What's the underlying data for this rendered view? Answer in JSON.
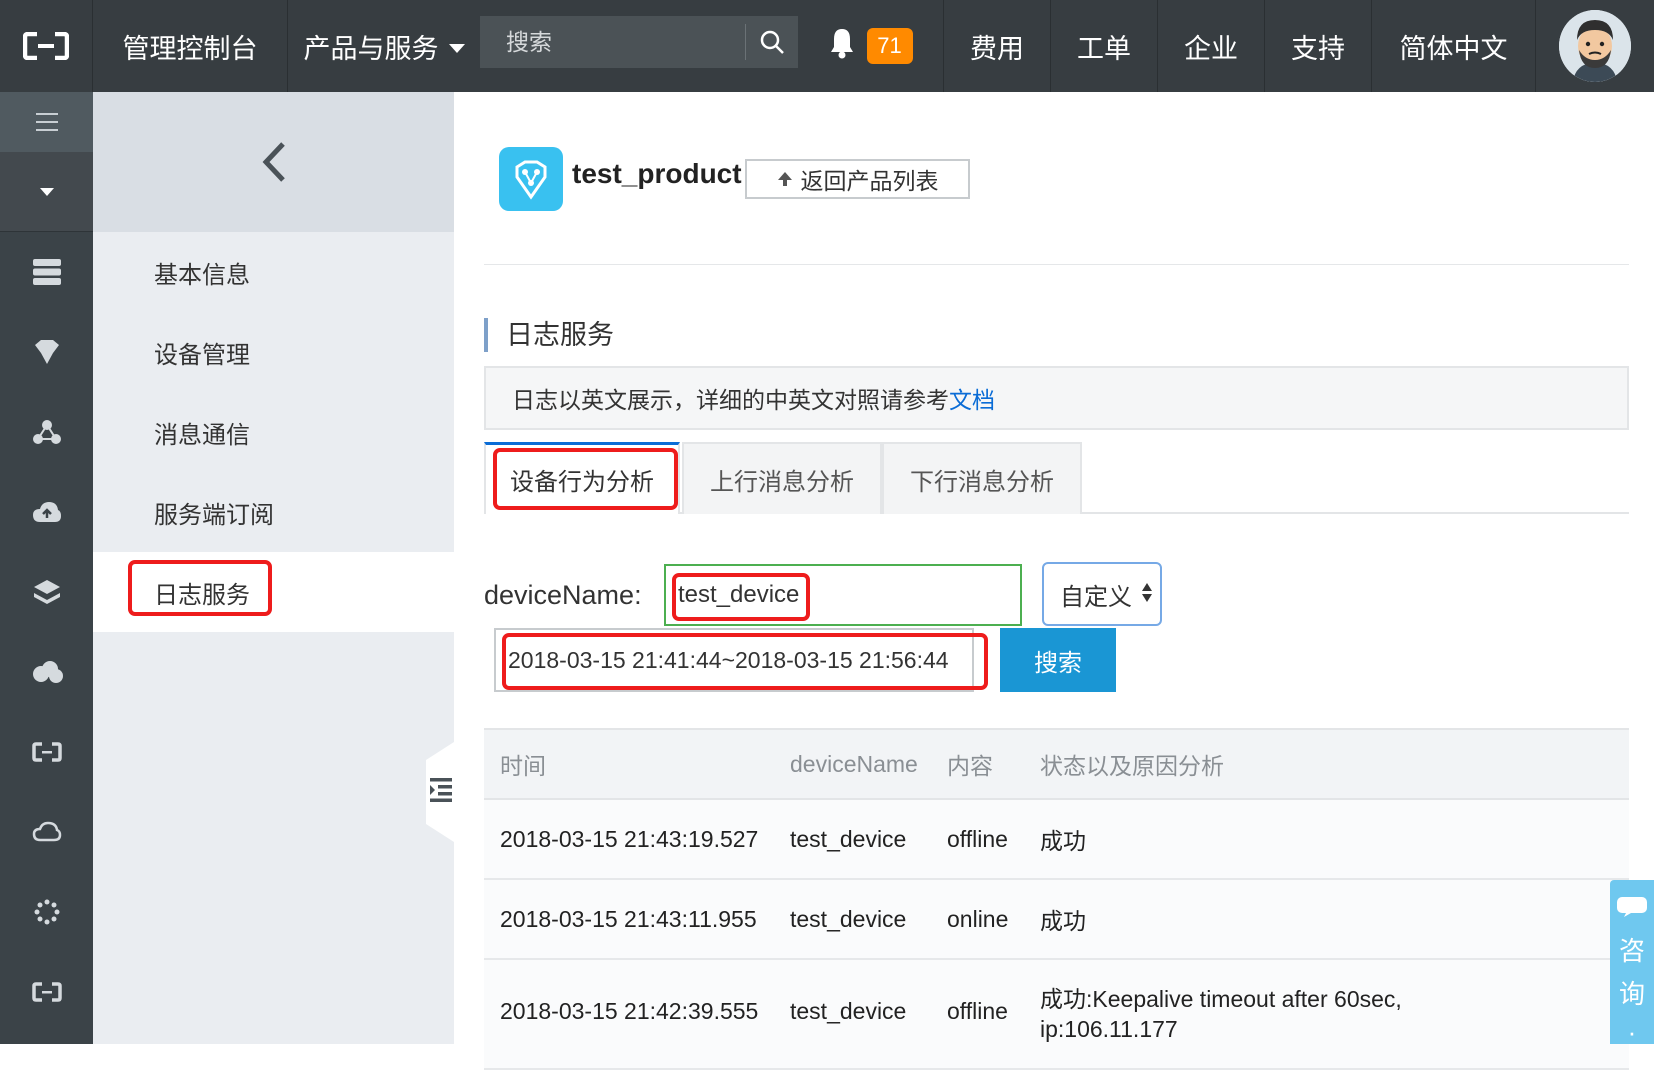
{
  "topbar": {
    "console": "管理控制台",
    "products": "产品与服务",
    "search_placeholder": "搜索",
    "notification_count": "71",
    "fee": "费用",
    "ticket": "工单",
    "enterprise": "企业",
    "support": "支持",
    "language": "简体中文"
  },
  "sidebar": {
    "items": [
      {
        "label": "基本信息"
      },
      {
        "label": "设备管理"
      },
      {
        "label": "消息通信"
      },
      {
        "label": "服务端订阅"
      },
      {
        "label": "日志服务"
      }
    ]
  },
  "product": {
    "name": "test_product",
    "back_label": "返回产品列表"
  },
  "section": {
    "title": "日志服务",
    "notice_text": "日志以英文展示，详细的中英文对照请参考",
    "notice_link": "文档"
  },
  "tabs": [
    {
      "label": "设备行为分析"
    },
    {
      "label": "上行消息分析"
    },
    {
      "label": "下行消息分析"
    }
  ],
  "filters": {
    "device_label": "deviceName:",
    "device_value": "test_device",
    "range_mode": "自定义",
    "time_range": "2018-03-15 21:41:44~2018-03-15 21:56:44",
    "search_label": "搜索"
  },
  "table": {
    "headers": [
      "时间",
      "deviceName",
      "内容",
      "状态以及原因分析"
    ],
    "rows": [
      {
        "time": "2018-03-15 21:43:19.527",
        "device": "test_device",
        "content": "offline",
        "status": "成功"
      },
      {
        "time": "2018-03-15 21:43:11.955",
        "device": "test_device",
        "content": "online",
        "status": "成功"
      },
      {
        "time": "2018-03-15 21:42:39.555",
        "device": "test_device",
        "content": "offline",
        "status": "成功:Keepalive timeout after 60sec,",
        "status_line2": "ip:106.11.177"
      }
    ]
  },
  "consult": {
    "chars": [
      "咨",
      "询",
      "·"
    ]
  },
  "colors": {
    "topbar": "#373d41",
    "accent": "#1a96d4",
    "highlight": "#ee1c1c",
    "offline": "#e60012",
    "online": "#1e8e1e"
  }
}
